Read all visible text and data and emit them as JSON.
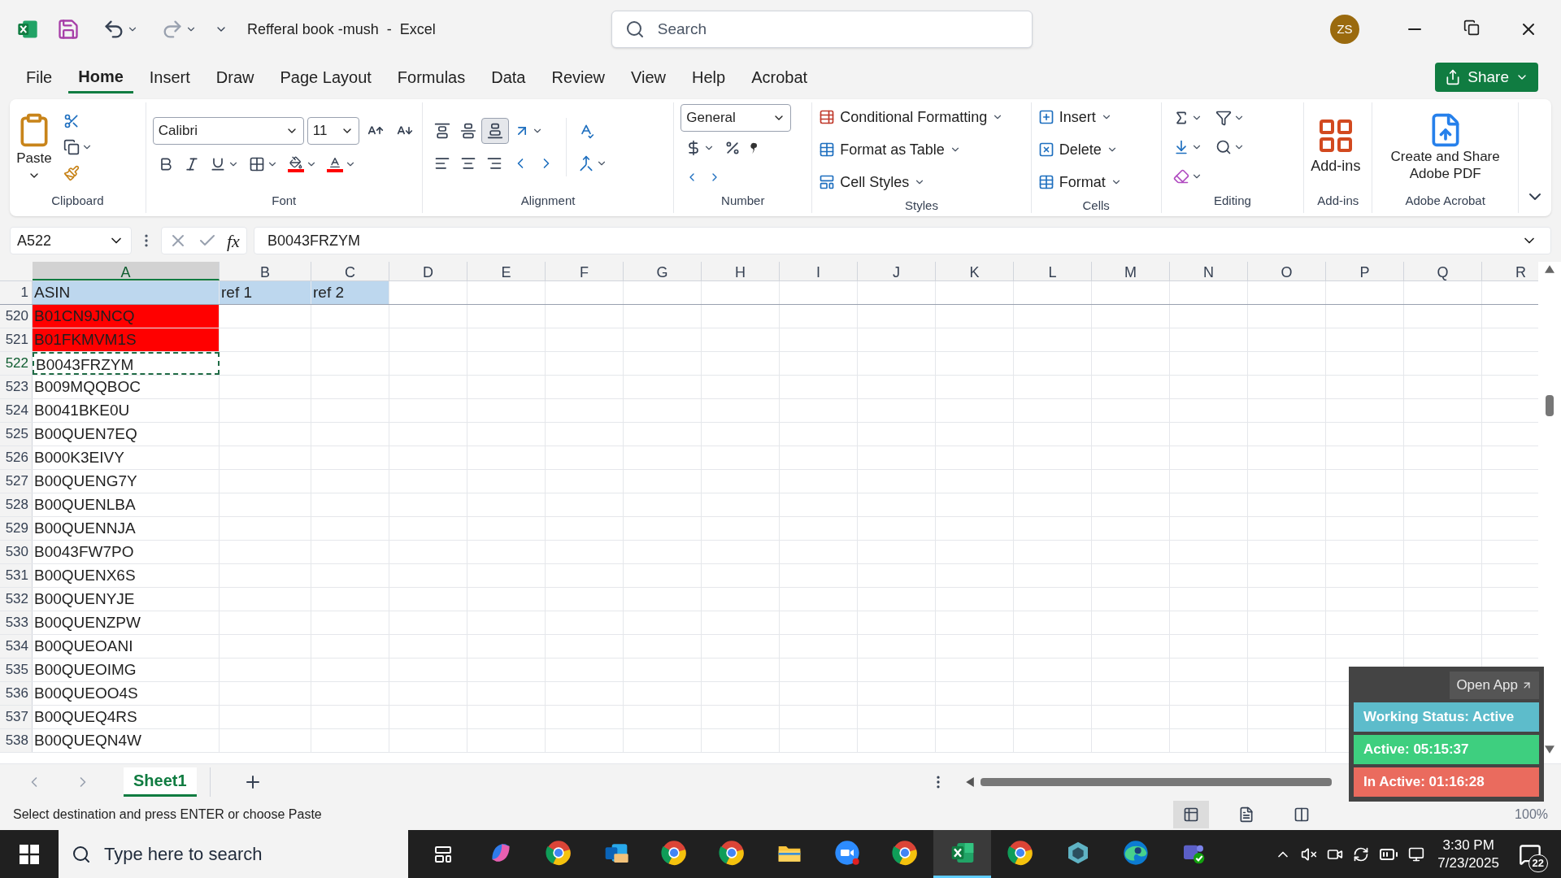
{
  "window": {
    "title": "Refferal book -mush  -  Excel",
    "search_placeholder": "Search",
    "avatar": "ZS"
  },
  "tabs": [
    {
      "label": "File",
      "selected": false
    },
    {
      "label": "Home",
      "selected": true
    },
    {
      "label": "Insert",
      "selected": false
    },
    {
      "label": "Draw",
      "selected": false
    },
    {
      "label": "Page Layout",
      "selected": false
    },
    {
      "label": "Formulas",
      "selected": false
    },
    {
      "label": "Data",
      "selected": false
    },
    {
      "label": "Review",
      "selected": false
    },
    {
      "label": "View",
      "selected": false
    },
    {
      "label": "Help",
      "selected": false
    },
    {
      "label": "Acrobat",
      "selected": false
    }
  ],
  "share_button": "Share",
  "ribbon": {
    "clipboard": {
      "label": "Clipboard",
      "paste": "Paste"
    },
    "font": {
      "label": "Font",
      "font_name": "Calibri",
      "font_size": "11"
    },
    "alignment": {
      "label": "Alignment",
      "vertical": [
        {
          "kind": "top",
          "selected": false
        },
        {
          "kind": "middle",
          "selected": false
        },
        {
          "kind": "bottom",
          "selected": true
        }
      ]
    },
    "number": {
      "label": "Number",
      "format": "General"
    },
    "styles": {
      "label": "Styles",
      "buttons": [
        "Conditional Formatting",
        "Format as Table",
        "Cell Styles"
      ]
    },
    "cells": {
      "label": "Cells",
      "buttons": [
        "Insert",
        "Delete",
        "Format"
      ]
    },
    "editing": {
      "label": "Editing"
    },
    "addins": {
      "label": "Add-ins",
      "button": "Add-ins"
    },
    "acrobat": {
      "label": "Adobe Acrobat",
      "button": "Create and Share Adobe PDF"
    }
  },
  "formula_bar": {
    "name_box": "A522",
    "function": "fx",
    "formula": "B0043FRZYM"
  },
  "columns": [
    {
      "label": "A",
      "selected": true
    },
    {
      "label": "B",
      "selected": false
    },
    {
      "label": "C",
      "selected": false
    },
    {
      "label": "D",
      "selected": false
    },
    {
      "label": "E",
      "selected": false
    },
    {
      "label": "F",
      "selected": false
    },
    {
      "label": "G",
      "selected": false
    },
    {
      "label": "H",
      "selected": false
    },
    {
      "label": "I",
      "selected": false
    },
    {
      "label": "J",
      "selected": false
    },
    {
      "label": "K",
      "selected": false
    },
    {
      "label": "L",
      "selected": false
    },
    {
      "label": "M",
      "selected": false
    },
    {
      "label": "N",
      "selected": false
    },
    {
      "label": "O",
      "selected": false
    },
    {
      "label": "P",
      "selected": false
    },
    {
      "label": "Q",
      "selected": false
    },
    {
      "label": "R",
      "selected": false
    }
  ],
  "rows": [
    {
      "number": "1",
      "cells": [
        "ASIN",
        "ref 1",
        "ref 2"
      ],
      "color": "#bdd7ee",
      "selected": false
    },
    {
      "number": "520",
      "cells": [
        "B01CN9JNCQ"
      ],
      "color": "#ff0000",
      "selected": false
    },
    {
      "number": "521",
      "cells": [
        "B01FKMVM1S"
      ],
      "color": "#ff0000",
      "selected": false
    },
    {
      "number": "522",
      "cells": [
        "B0043FRZYM"
      ],
      "selected": true
    },
    {
      "number": "523",
      "cells": [
        "B009MQQBOC"
      ],
      "selected": false
    },
    {
      "number": "524",
      "cells": [
        "B0041BKE0U"
      ],
      "selected": false
    },
    {
      "number": "525",
      "cells": [
        "B00QUEN7EQ"
      ],
      "selected": false
    },
    {
      "number": "526",
      "cells": [
        "B000K3EIVY"
      ],
      "selected": false
    },
    {
      "number": "527",
      "cells": [
        "B00QUENG7Y"
      ],
      "selected": false
    },
    {
      "number": "528",
      "cells": [
        "B00QUENLBA"
      ],
      "selected": false
    },
    {
      "number": "529",
      "cells": [
        "B00QUENNJA"
      ],
      "selected": false
    },
    {
      "number": "530",
      "cells": [
        "B0043FW7PO"
      ],
      "selected": false
    },
    {
      "number": "531",
      "cells": [
        "B00QUENX6S"
      ],
      "selected": false
    },
    {
      "number": "532",
      "cells": [
        "B00QUENYJE"
      ],
      "selected": false
    },
    {
      "number": "533",
      "cells": [
        "B00QUENZPW"
      ],
      "selected": false
    },
    {
      "number": "534",
      "cells": [
        "B00QUEOANI"
      ],
      "selected": false
    },
    {
      "number": "535",
      "cells": [
        "B00QUEOIMG"
      ],
      "selected": false
    },
    {
      "number": "536",
      "cells": [
        "B00QUEOO4S"
      ],
      "selected": false
    },
    {
      "number": "537",
      "cells": [
        "B00QUEQ4RS"
      ],
      "selected": false
    },
    {
      "number": "538",
      "cells": [
        "B00QUEQN4W"
      ],
      "selected": false
    }
  ],
  "sheet_tabs": [
    {
      "label": "Sheet1",
      "selected": true
    }
  ],
  "status_bar": {
    "message": "Select destination and press ENTER or choose Paste",
    "zoom": "100%"
  },
  "views": [
    {
      "kind": "normal",
      "selected": true
    },
    {
      "kind": "page_layout",
      "selected": false
    },
    {
      "kind": "page_break",
      "selected": false
    }
  ],
  "tracker": {
    "link": "Open App",
    "items": [
      {
        "label": "Working Status: Active",
        "color": "#5dbccb"
      },
      {
        "label": "Active: 05:15:37",
        "color": "#3ecf7f"
      },
      {
        "label": "In Active: 01:16:28",
        "color": "#ea6b5e"
      }
    ]
  },
  "taskbar": {
    "search_placeholder": "Type here to search",
    "apps": [
      {
        "kind": "copilot",
        "selected": false
      },
      {
        "kind": "chrome",
        "selected": false
      },
      {
        "kind": "outlook",
        "selected": false
      },
      {
        "kind": "chrome",
        "selected": false
      },
      {
        "kind": "chrome",
        "selected": false
      },
      {
        "kind": "folder",
        "selected": false
      },
      {
        "kind": "zoom",
        "selected": false
      },
      {
        "kind": "chrome",
        "selected": false
      },
      {
        "kind": "excel",
        "selected": true
      },
      {
        "kind": "chrome",
        "selected": false
      },
      {
        "kind": "cube",
        "selected": false
      },
      {
        "kind": "edge",
        "selected": false
      },
      {
        "kind": "teams",
        "selected": false
      }
    ],
    "time": "3:30 PM",
    "date": "7/23/2025",
    "notifications": "22"
  }
}
